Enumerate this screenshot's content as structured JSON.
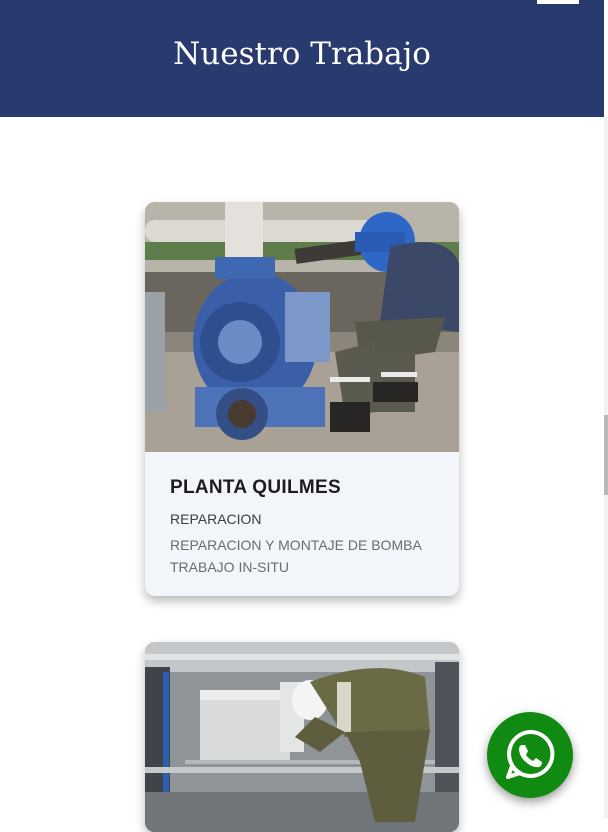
{
  "header": {
    "title": "Nuestro Trabajo"
  },
  "cards": [
    {
      "title": "PLANTA QUILMES",
      "category": "REPARACION",
      "description_lines": [
        "REPARACION Y MONTAJE DE BOMBA",
        "TRABAJO IN-SITU"
      ]
    }
  ],
  "icons": {
    "menu": "menu-icon",
    "whatsapp": "whatsapp-icon"
  },
  "colors": {
    "header_bg": "#293a6e",
    "card_bg": "#f2f5f9",
    "whatsapp_green": "#118a11"
  }
}
